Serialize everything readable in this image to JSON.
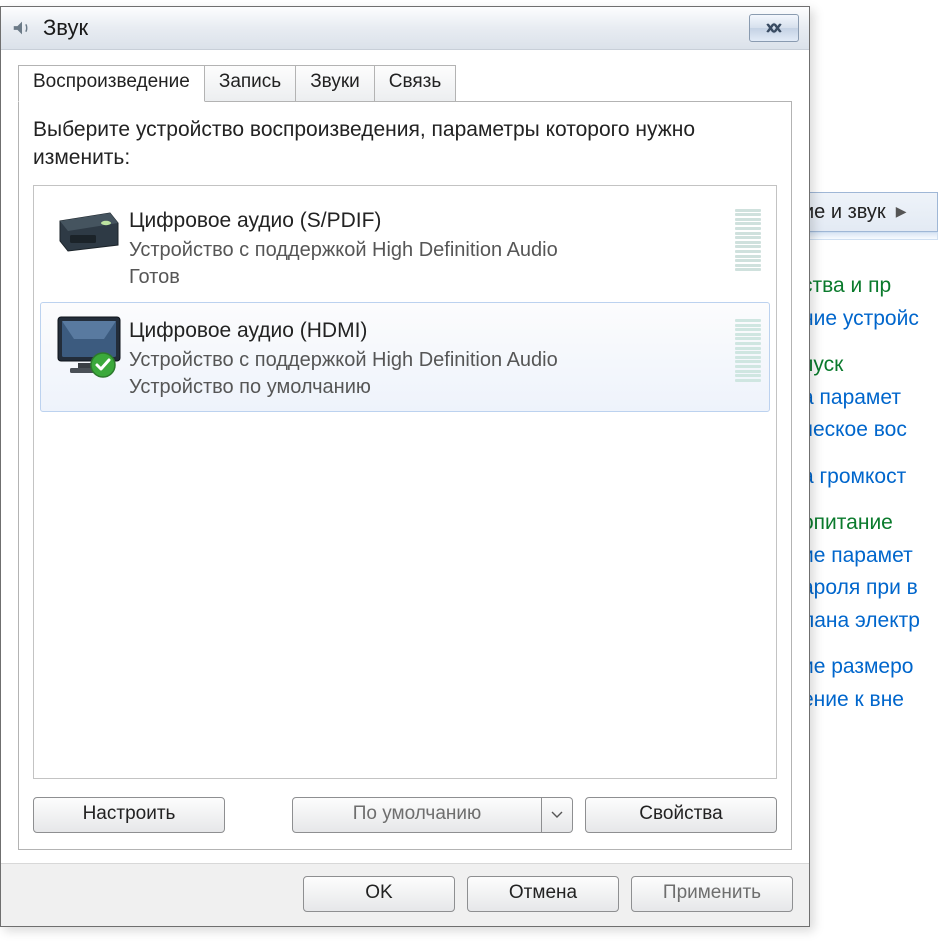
{
  "dialog": {
    "title": "Звук",
    "tabs": [
      "Воспроизведение",
      "Запись",
      "Звуки",
      "Связь"
    ],
    "active_tab": 0,
    "prompt": "Выберите устройство воспроизведения, параметры которого нужно изменить:",
    "devices": [
      {
        "name": "Цифровое аудио (S/PDIF)",
        "desc": "Устройство с поддержкой High Definition Audio",
        "status": "Готов",
        "icon": "audio-box",
        "default": false,
        "selected": false
      },
      {
        "name": "Цифровое аудио (HDMI)",
        "desc": "Устройство с поддержкой High Definition Audio",
        "status": "Устройство по умолчанию",
        "icon": "monitor",
        "default": true,
        "selected": true
      }
    ],
    "buttons": {
      "configure": "Настроить",
      "set_default": "По умолчанию",
      "properties": "Свойства",
      "ok": "OK",
      "cancel": "Отмена",
      "apply": "Применить"
    }
  },
  "background": {
    "breadcrumb": "ие и звук",
    "sections": [
      {
        "head": "ства и пр",
        "links": [
          "ние устройс"
        ]
      },
      {
        "head": "пуск",
        "links": [
          "а парамет",
          "ческое вос"
        ]
      },
      {
        "head": "",
        "links": [
          "а громкост"
        ]
      },
      {
        "head": "опитание",
        "links": [
          "ие парамет",
          "ароля при в",
          "лана электр"
        ]
      },
      {
        "head": "",
        "links": [
          "ие размеро",
          "ение к вне"
        ]
      }
    ]
  }
}
